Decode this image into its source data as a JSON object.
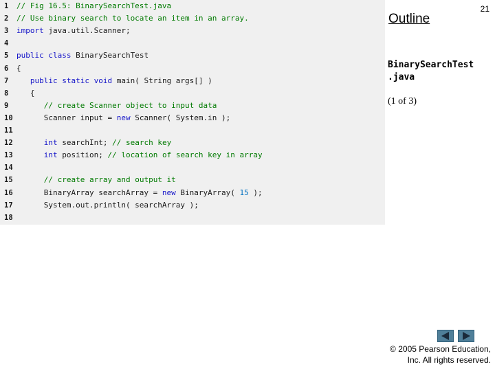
{
  "slide_number": "21",
  "outline_title": "Outline",
  "filename_line1": "BinarySearchTest",
  "filename_line2": ".java",
  "page_indicator": "(1 of 3)",
  "copyright_line1": "© 2005 Pearson Education,",
  "copyright_line2": "Inc.  All rights reserved.",
  "nav": {
    "prev_icon": "triangle-left-icon",
    "next_icon": "triangle-right-icon",
    "button_color": "#4f7f99"
  },
  "colors": {
    "comment": "#007a00",
    "keyword": "#1414c8",
    "number": "#0070c0",
    "code_background": "#f0f0f0"
  },
  "code_lines": [
    {
      "n": "1",
      "tokens": [
        {
          "t": "// Fig 16.5: BinarySearchTest.java",
          "c": "comment"
        }
      ]
    },
    {
      "n": "2",
      "tokens": [
        {
          "t": "// Use binary search to locate an item in an array.",
          "c": "comment"
        }
      ]
    },
    {
      "n": "3",
      "tokens": [
        {
          "t": "import",
          "c": "kw"
        },
        {
          "t": " java.util.Scanner;",
          "c": ""
        }
      ]
    },
    {
      "n": "4",
      "tokens": []
    },
    {
      "n": "5",
      "tokens": [
        {
          "t": "public class",
          "c": "kw"
        },
        {
          "t": " BinarySearchTest",
          "c": ""
        }
      ]
    },
    {
      "n": "6",
      "tokens": [
        {
          "t": "{",
          "c": ""
        }
      ]
    },
    {
      "n": "7",
      "tokens": [
        {
          "t": "   ",
          "c": ""
        },
        {
          "t": "public static void",
          "c": "kw"
        },
        {
          "t": " main( String args[] )",
          "c": ""
        }
      ]
    },
    {
      "n": "8",
      "tokens": [
        {
          "t": "   {",
          "c": ""
        }
      ]
    },
    {
      "n": "9",
      "tokens": [
        {
          "t": "      ",
          "c": ""
        },
        {
          "t": "// create Scanner object to input data",
          "c": "comment"
        }
      ]
    },
    {
      "n": "10",
      "tokens": [
        {
          "t": "      Scanner input = ",
          "c": ""
        },
        {
          "t": "new",
          "c": "kw"
        },
        {
          "t": " Scanner( System.in );",
          "c": ""
        }
      ]
    },
    {
      "n": "11",
      "tokens": []
    },
    {
      "n": "12",
      "tokens": [
        {
          "t": "      ",
          "c": ""
        },
        {
          "t": "int",
          "c": "kw"
        },
        {
          "t": " searchInt; ",
          "c": ""
        },
        {
          "t": "// search key",
          "c": "comment"
        }
      ]
    },
    {
      "n": "13",
      "tokens": [
        {
          "t": "      ",
          "c": ""
        },
        {
          "t": "int",
          "c": "kw"
        },
        {
          "t": " position; ",
          "c": ""
        },
        {
          "t": "// location of search key in array",
          "c": "comment"
        }
      ]
    },
    {
      "n": "14",
      "tokens": []
    },
    {
      "n": "15",
      "tokens": [
        {
          "t": "      ",
          "c": ""
        },
        {
          "t": "// create array and output it",
          "c": "comment"
        }
      ]
    },
    {
      "n": "16",
      "tokens": [
        {
          "t": "      BinaryArray searchArray = ",
          "c": ""
        },
        {
          "t": "new",
          "c": "kw"
        },
        {
          "t": " BinaryArray( ",
          "c": ""
        },
        {
          "t": "15",
          "c": "num"
        },
        {
          "t": " );",
          "c": ""
        }
      ]
    },
    {
      "n": "17",
      "tokens": [
        {
          "t": "      System.out.println( searchArray );",
          "c": ""
        }
      ]
    },
    {
      "n": "18",
      "tokens": []
    }
  ]
}
